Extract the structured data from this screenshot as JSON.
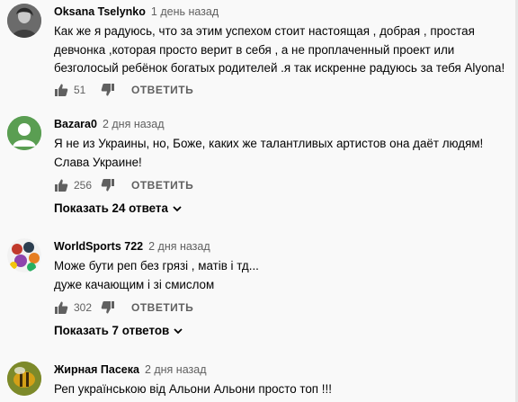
{
  "comments": [
    {
      "author": "Oksana Tselynko",
      "time": "1 день назад",
      "lines": [
        "Как же я радуюсь, что за этим успехом стоит настоящая , добрая , простая",
        "девчонка ,которая просто верит в себя , а не проплаченный проект или",
        "безголосый ребёнок богатых родителей .я так искренне радуюсь за тебя  Alyona!"
      ],
      "likes": "51",
      "reply_label": "ОТВЕТИТЬ",
      "avatar_icon": "photo-avatar-icon"
    },
    {
      "author": "Bazara0",
      "time": "2 дня назад",
      "lines": [
        "Я не из Украины, но, Боже, каких же талантливых артистов она даёт людям!",
        "Слава Украине!"
      ],
      "likes": "256",
      "reply_label": "ОТВЕТИТЬ",
      "show_replies": "Показать 24 ответа",
      "avatar_icon": "default-user-icon",
      "avatar_color": "#5a9e52"
    },
    {
      "author": "WorldSports 722",
      "time": "2 дня назад",
      "lines": [
        "Може бути реп без грязі , матів і тд...",
        "дуже качающим і зі смислом"
      ],
      "likes": "302",
      "reply_label": "ОТВЕТИТЬ",
      "show_replies": "Показать 7 ответов",
      "avatar_icon": "sports-collage-avatar-icon"
    },
    {
      "author": "Жирная Пасека",
      "time": "2 дня назад",
      "lines": [
        "Реп українською від Альони Альони просто топ !!!"
      ],
      "avatar_icon": "bee-photo-avatar-icon"
    }
  ]
}
